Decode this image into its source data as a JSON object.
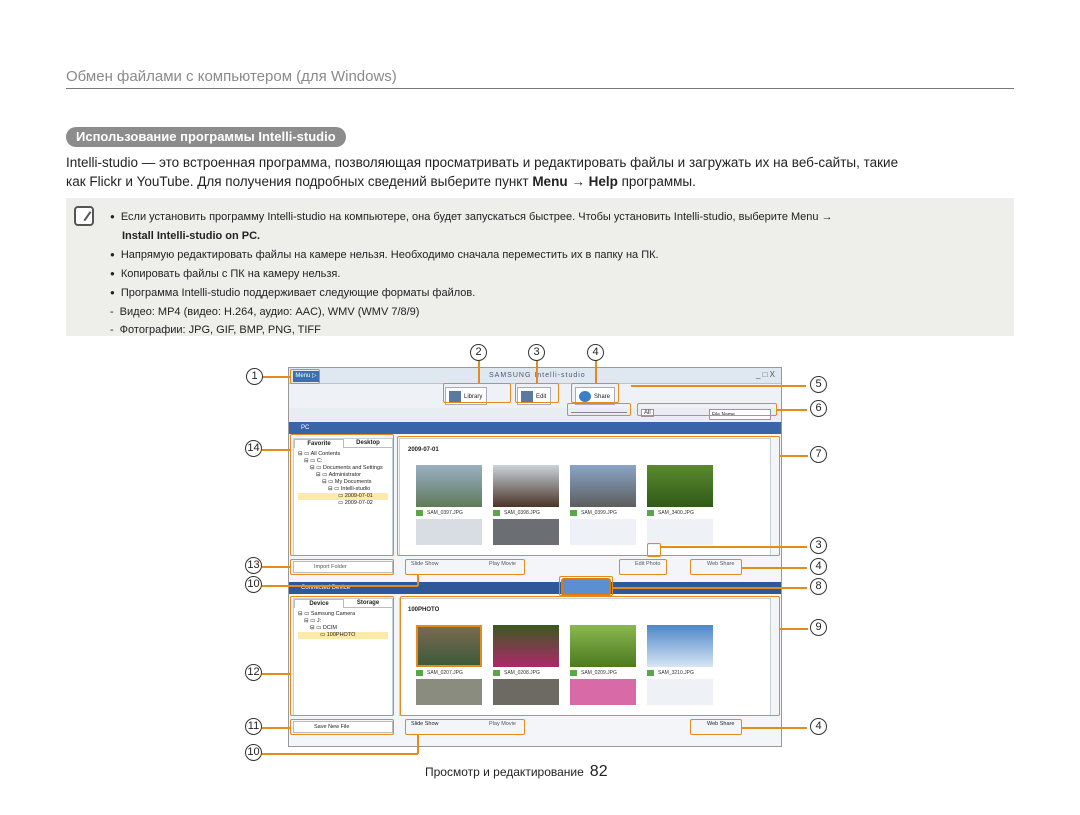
{
  "header": {
    "title": "Обмен файлами с компьютером (для Windows)"
  },
  "section": {
    "title": "Использование программы Intelli-studio"
  },
  "intro": {
    "line1": "Intelli-studio — это встроенная программа, позволяющая просматривать и редактировать файлы и загружать их на веб-сайты, такие",
    "line2_a": "как Flickr и YouTube. Для получения подробных сведений выберите пункт ",
    "line2_menu": "Menu",
    "line2_arrow": " → ",
    "line2_help": "Help",
    "line2_b": " программы."
  },
  "note": {
    "items": [
      "Если установить программу Intelli-studio на компьютере, она будет запускаться быстрее. Чтобы установить Intelli-studio, выберите Menu →",
      "Install Intelli-studio on PC.",
      "Напрямую редактировать файлы на камере нельзя. Необходимо сначала переместить их в папку на ПК.",
      "Копировать файлы с ПК на камеру нельзя.",
      "Программа Intelli-studio поддерживает следующие форматы файлов.",
      "Видео: MP4 (видео: H.264, аудио: AAC), WMV (WMV 7/8/9)",
      "Фотографии: JPG, GIF, BMP, PNG, TIFF"
    ]
  },
  "app": {
    "menu": "Menu ▷",
    "brand": "SAMSUNG Intelli-studio",
    "window_controls": "_ □ X",
    "library": "Library",
    "edit": "Edit",
    "share": "Share",
    "all": "All",
    "file_name": "File Name",
    "pc_label": "PC",
    "tabs_top": [
      "Favorite",
      "Desktop"
    ],
    "tree_top": [
      "All Contents",
      "C:",
      "Documents and Settings",
      "Administrator",
      "My Documents",
      "Intelli-studio",
      "2009-07-01",
      "2009-07-02"
    ],
    "folder_top": "2009-07-01",
    "captions_top": [
      "SAM_0397.JPG",
      "SAM_0398.JPG",
      "SAM_0399.JPG",
      "SAM_3400.JPG"
    ],
    "import_folder": "Import Folder",
    "slide_show": "Slide Show",
    "play_movie": "Play Movie",
    "edit_photo": "Edit Photo",
    "web_share": "Web Share",
    "connected_device": "Connected Device",
    "tabs_bottom": [
      "Device",
      "Storage"
    ],
    "tree_bottom": [
      "Samsung Camera",
      "J:",
      "DCIM",
      "100PHOTO"
    ],
    "folder_bottom": "100PHOTO",
    "captions_bottom": [
      "SAM_0207.JPG",
      "SAM_0208.JPG",
      "SAM_0209.JPG",
      "SAM_3210.JPG"
    ],
    "save_new_file": "Save New File"
  },
  "callouts": [
    "1",
    "2",
    "3",
    "4",
    "5",
    "6",
    "7",
    "3",
    "4",
    "8",
    "9",
    "4",
    "14",
    "13",
    "10",
    "12",
    "11",
    "10"
  ],
  "footer": {
    "section": "Просмотр и редактирование",
    "page": "82"
  }
}
